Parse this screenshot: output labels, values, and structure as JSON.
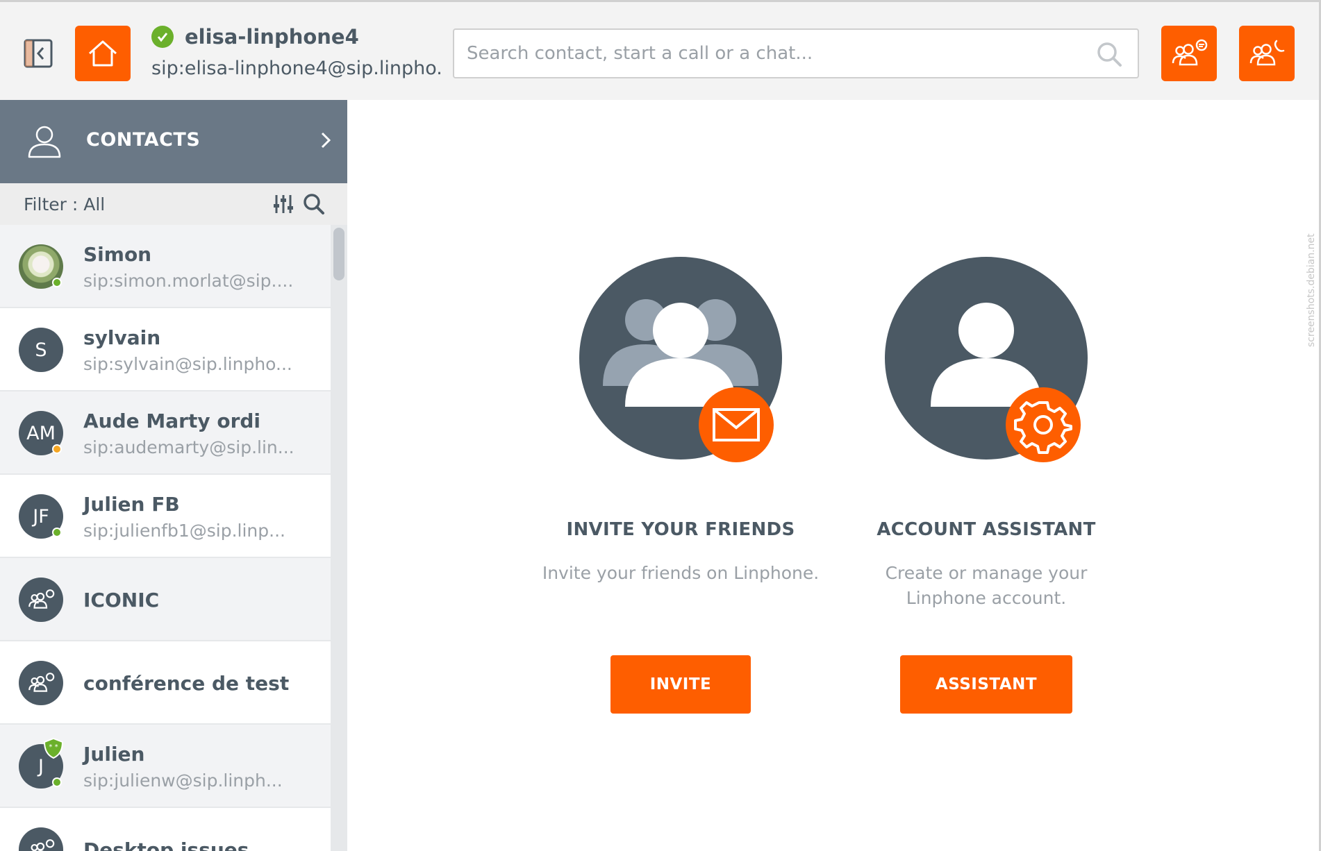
{
  "account": {
    "name": "elisa-linphone4",
    "sip": "sip:elisa-linphone4@sip.linpho..."
  },
  "search": {
    "placeholder": "Search contact, start a call or a chat..."
  },
  "sidebar": {
    "contacts_label": "CONTACTS",
    "filter_label": "Filter : All",
    "contacts": [
      {
        "name": "Simon",
        "sip": "sip:simon.morlat@sip....",
        "initials": "",
        "presence": "online"
      },
      {
        "name": "sylvain",
        "sip": "sip:sylvain@sip.linpho...",
        "initials": "S",
        "presence": ""
      },
      {
        "name": "Aude Marty ordi",
        "sip": "sip:audemarty@sip.lin...",
        "initials": "AM",
        "presence": "away"
      },
      {
        "name": "Julien FB",
        "sip": "sip:julienfb1@sip.linp...",
        "initials": "JF",
        "presence": "online"
      },
      {
        "name": "ICONIC",
        "sip": "",
        "initials": "",
        "presence": ""
      },
      {
        "name": "conférence de test",
        "sip": "",
        "initials": "",
        "presence": ""
      },
      {
        "name": "Julien",
        "sip": "sip:julienw@sip.linph...",
        "initials": "J",
        "presence": "online"
      },
      {
        "name": "Desktop issues",
        "sip": "",
        "initials": "",
        "presence": ""
      }
    ]
  },
  "main": {
    "invite": {
      "title": "INVITE YOUR FRIENDS",
      "description": "Invite your friends on Linphone.",
      "button": "INVITE"
    },
    "assistant": {
      "title": "ACCOUNT ASSISTANT",
      "description_line1": "Create or manage your",
      "description_line2": "Linphone account.",
      "button": "ASSISTANT"
    }
  },
  "watermark": "screenshots.debian.net",
  "colors": {
    "accent": "#fe5e00",
    "dark": "#4b5964",
    "header": "#6a7886",
    "online": "#6bb02b",
    "away": "#f5a623"
  }
}
